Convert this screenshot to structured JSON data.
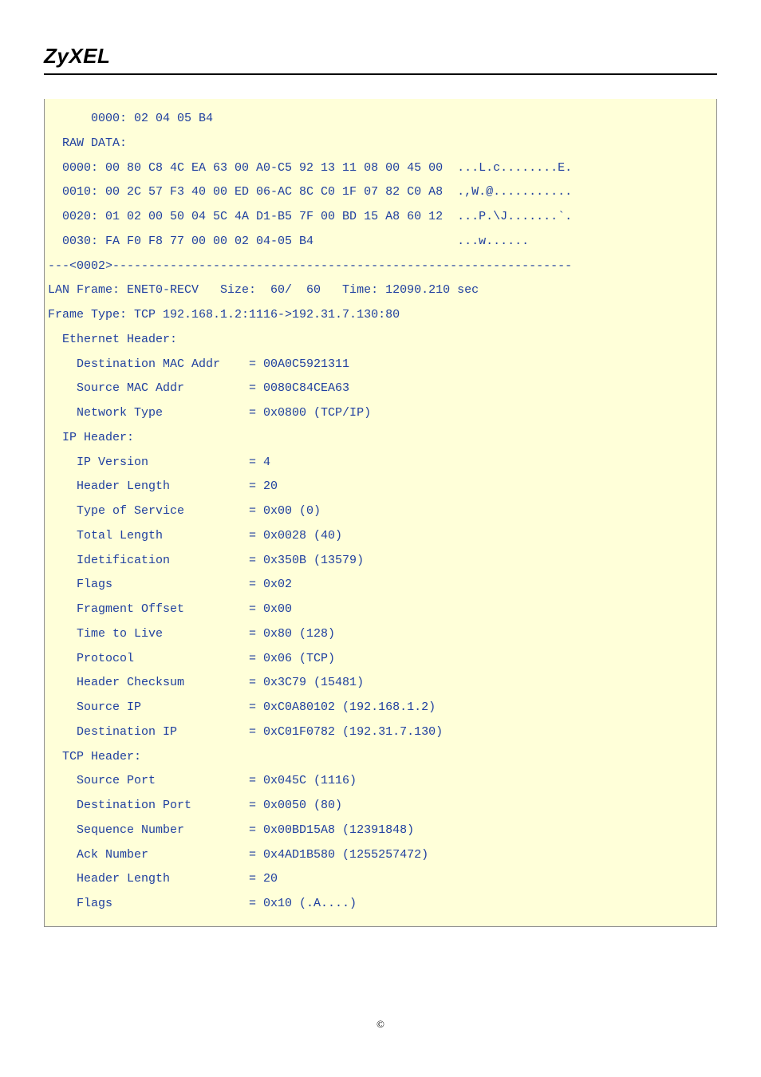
{
  "logo": "ZyXEL",
  "footer": "©",
  "lines": {
    "l00": "      0000: 02 04 05 B4",
    "l01": "",
    "l02": "  RAW DATA:",
    "l03": "  0000: 00 80 C8 4C EA 63 00 A0-C5 92 13 11 08 00 45 00  ...L.c........E.",
    "l04": "  0010: 00 2C 57 F3 40 00 ED 06-AC 8C C0 1F 07 82 C0 A8  .,W.@...........",
    "l05": "  0020: 01 02 00 50 04 5C 4A D1-B5 7F 00 BD 15 A8 60 12  ...P.\\J.......`.",
    "l06": "  0030: FA F0 F8 77 00 00 02 04-05 B4                    ...w......",
    "l07": "---<0002>----------------------------------------------------------------",
    "l08": "LAN Frame: ENET0-RECV   Size:  60/  60   Time: 12090.210 sec",
    "l09": "Frame Type: TCP 192.168.1.2:1116->192.31.7.130:80",
    "l10": "",
    "l11": "  Ethernet Header:",
    "l12": "    Destination MAC Addr    = 00A0C5921311",
    "l13": "    Source MAC Addr         = 0080C84CEA63",
    "l14": "    Network Type            = 0x0800 (TCP/IP)",
    "l15": "",
    "l16": "  IP Header:",
    "l17": "    IP Version              = 4",
    "l18": "    Header Length           = 20",
    "l19": "    Type of Service         = 0x00 (0)",
    "l20": "    Total Length            = 0x0028 (40)",
    "l21": "    Idetification           = 0x350B (13579)",
    "l22": "    Flags                   = 0x02",
    "l23": "    Fragment Offset         = 0x00",
    "l24": "    Time to Live            = 0x80 (128)",
    "l25": "    Protocol                = 0x06 (TCP)",
    "l26": "    Header Checksum         = 0x3C79 (15481)",
    "l27": "    Source IP               = 0xC0A80102 (192.168.1.2)",
    "l28": "    Destination IP          = 0xC01F0782 (192.31.7.130)",
    "l29": "",
    "l30": "  TCP Header:",
    "l31": "    Source Port             = 0x045C (1116)",
    "l32": "    Destination Port        = 0x0050 (80)",
    "l33": "    Sequence Number         = 0x00BD15A8 (12391848)",
    "l34": "    Ack Number              = 0x4AD1B580 (1255257472)",
    "l35": "    Header Length           = 20",
    "l36": "    Flags                   = 0x10 (.A....)"
  }
}
